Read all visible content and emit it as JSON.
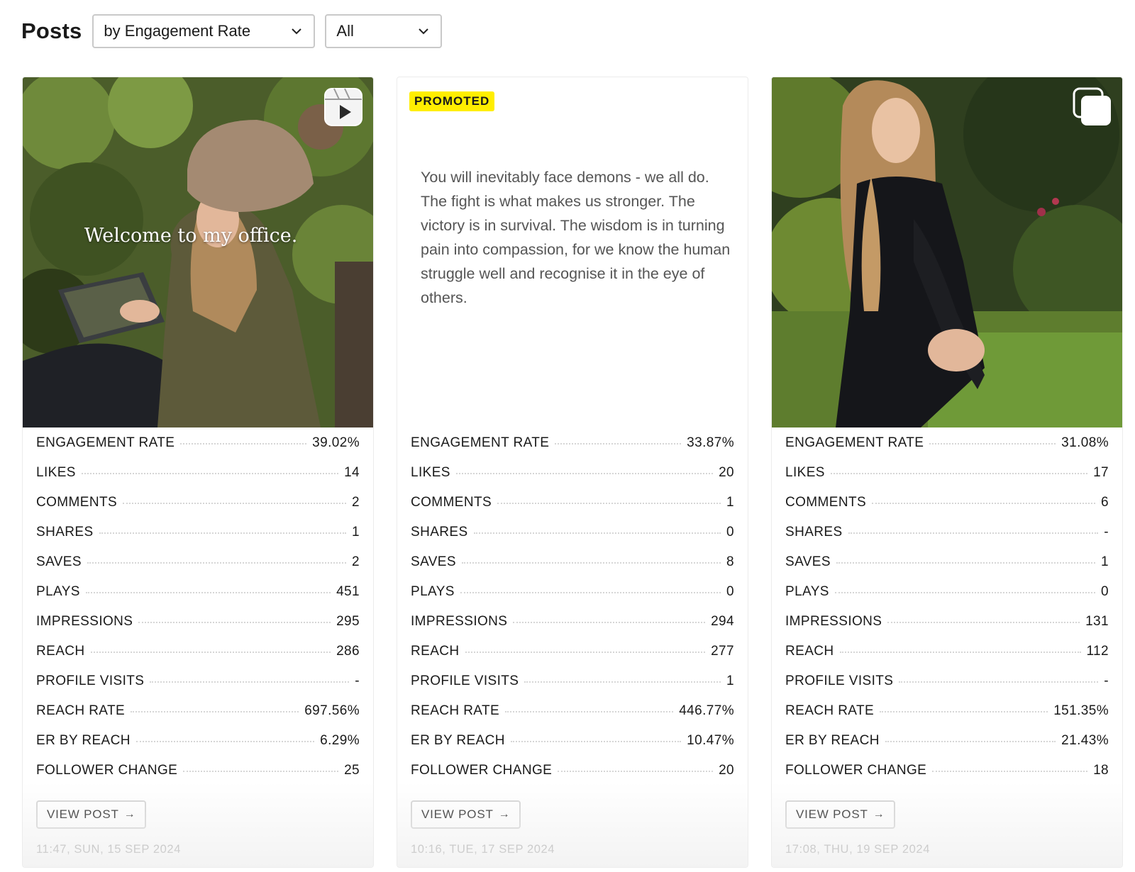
{
  "header": {
    "title": "Posts",
    "sort_select": {
      "value": "by Engagement Rate",
      "icon": "chevron-down-icon"
    },
    "filter_select": {
      "value": "All",
      "icon": "chevron-down-icon"
    }
  },
  "posts": [
    {
      "type_icon": "reel-icon",
      "caption_overlay": "Welcome to my office.",
      "stats": [
        {
          "label": "ENGAGEMENT RATE",
          "value": "39.02%"
        },
        {
          "label": "LIKES",
          "value": "14"
        },
        {
          "label": "COMMENTS",
          "value": "2"
        },
        {
          "label": "SHARES",
          "value": "1"
        },
        {
          "label": "SAVES",
          "value": "2"
        },
        {
          "label": "PLAYS",
          "value": "451"
        },
        {
          "label": "IMPRESSIONS",
          "value": "295"
        },
        {
          "label": "REACH",
          "value": "286"
        },
        {
          "label": "PROFILE VISITS",
          "value": "-"
        },
        {
          "label": "REACH RATE",
          "value": "697.56%"
        },
        {
          "label": "ER BY REACH",
          "value": "6.29%"
        },
        {
          "label": "FOLLOWER CHANGE",
          "value": "25"
        }
      ],
      "view_button": "VIEW POST",
      "timestamp": "11:47, SUN, 15 SEP 2024"
    },
    {
      "badge": "PROMOTED",
      "quote": "You will inevitably face demons - we all do. The fight is what makes us stronger. The victory is in survival. The wisdom is in turning pain into compassion, for we know the human struggle well and recognise it in the eye of others.",
      "stats": [
        {
          "label": "ENGAGEMENT RATE",
          "value": "33.87%"
        },
        {
          "label": "LIKES",
          "value": "20"
        },
        {
          "label": "COMMENTS",
          "value": "1"
        },
        {
          "label": "SHARES",
          "value": "0"
        },
        {
          "label": "SAVES",
          "value": "8"
        },
        {
          "label": "PLAYS",
          "value": "0"
        },
        {
          "label": "IMPRESSIONS",
          "value": "294"
        },
        {
          "label": "REACH",
          "value": "277"
        },
        {
          "label": "PROFILE VISITS",
          "value": "1"
        },
        {
          "label": "REACH RATE",
          "value": "446.77%"
        },
        {
          "label": "ER BY REACH",
          "value": "10.47%"
        },
        {
          "label": "FOLLOWER CHANGE",
          "value": "20"
        }
      ],
      "view_button": "VIEW POST",
      "timestamp": "10:16, TUE, 17 SEP 2024"
    },
    {
      "type_icon": "carousel-icon",
      "stats": [
        {
          "label": "ENGAGEMENT RATE",
          "value": "31.08%"
        },
        {
          "label": "LIKES",
          "value": "17"
        },
        {
          "label": "COMMENTS",
          "value": "6"
        },
        {
          "label": "SHARES",
          "value": "-"
        },
        {
          "label": "SAVES",
          "value": "1"
        },
        {
          "label": "PLAYS",
          "value": "0"
        },
        {
          "label": "IMPRESSIONS",
          "value": "131"
        },
        {
          "label": "REACH",
          "value": "112"
        },
        {
          "label": "PROFILE VISITS",
          "value": "-"
        },
        {
          "label": "REACH RATE",
          "value": "151.35%"
        },
        {
          "label": "ER BY REACH",
          "value": "21.43%"
        },
        {
          "label": "FOLLOWER CHANGE",
          "value": "18"
        }
      ],
      "view_button": "VIEW POST",
      "timestamp": "17:08, THU, 19 SEP 2024"
    }
  ],
  "colors": {
    "promoted_badge": "#ffee00",
    "timestamp": "#a3a3a3",
    "border": "#d4d4d4"
  }
}
